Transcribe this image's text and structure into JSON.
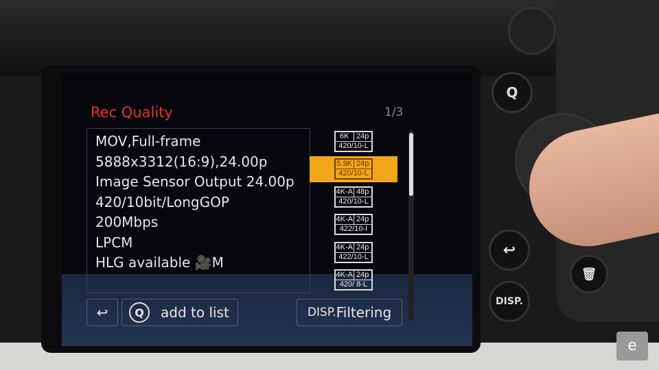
{
  "screen": {
    "title": "Rec Quality",
    "page_indicator": "1/3",
    "info_lines": [
      "MOV,Full-frame",
      "5888x3312(16:9),24.00p",
      "Image Sensor Output 24.00p",
      "420/10bit/LongGOP",
      "200Mbps",
      "LPCM",
      "HLG available 🎥M"
    ],
    "formats": [
      {
        "res": "6K",
        "fps": "24p",
        "codec": "420/10-L",
        "selected": false
      },
      {
        "res": "5.9K",
        "fps": "24p",
        "codec": "420/10-L",
        "selected": true
      },
      {
        "res": "4K-A",
        "fps": "48p",
        "codec": "420/10-L",
        "selected": false
      },
      {
        "res": "4K-A",
        "fps": "24p",
        "codec": "422/10-I",
        "selected": false
      },
      {
        "res": "4K-A",
        "fps": "24p",
        "codec": "422/10-L",
        "selected": false
      },
      {
        "res": "4K-A",
        "fps": "24p",
        "codec": "420/ 8-L",
        "selected": false
      }
    ],
    "selected_color": "#f0a81a",
    "title_color": "#e8312a",
    "back_icon": "return-arrow-icon",
    "q_label": "Q",
    "add_to_list": "add to list",
    "disp_label": "DISP.",
    "filtering": "Filtering"
  },
  "camera_buttons": {
    "q": "Q",
    "disp": "DISP.",
    "back": "↩",
    "trash": "🗑"
  },
  "watermark": "e"
}
